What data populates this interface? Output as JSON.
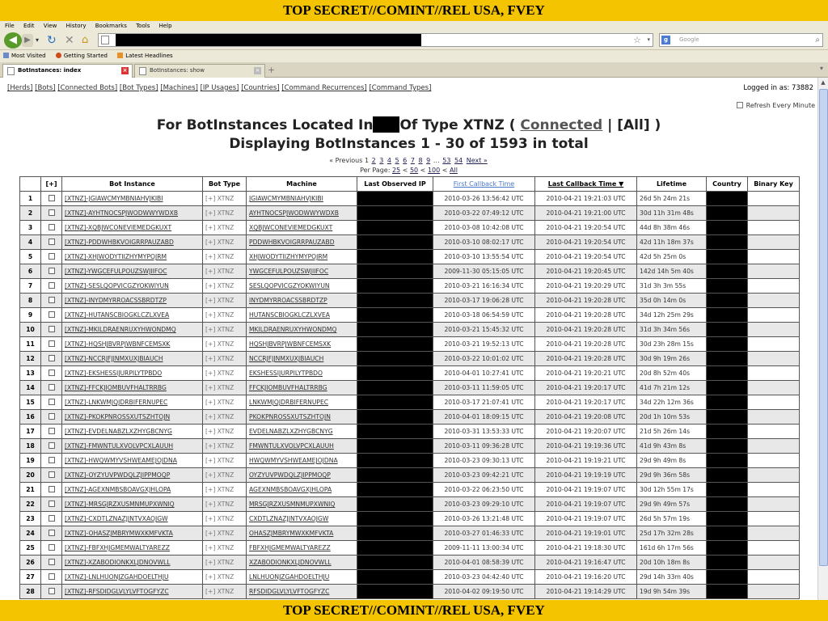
{
  "classification": "TOP SECRET//COMINT//REL USA, FVEY",
  "browser": {
    "menu": [
      "File",
      "Edit",
      "View",
      "History",
      "Bookmarks",
      "Tools",
      "Help"
    ],
    "search_placeholder": "Google",
    "bookmarks": [
      "Most Visited",
      "Getting Started",
      "Latest Headlines"
    ],
    "tabs": [
      {
        "label": "BotInstances: index",
        "active": true
      },
      {
        "label": "BotInstances: show",
        "active": false
      }
    ]
  },
  "nav": {
    "links": [
      "[Herds]",
      "[Bots]",
      "[Connected Bots]",
      "[Bot Types]",
      "[Machines]",
      "[IP Usages]",
      "[Countries]",
      "[Command Recurrences]",
      "[Command Types]"
    ],
    "logged_in_label": "Logged in as: 73882",
    "refresh_label": "Refresh Every Minute"
  },
  "heading": {
    "prefix": "For BotInstances Located In",
    "type_text": "Of Type XTNZ ( ",
    "connected": "Connected",
    "sep": " | ",
    "all": "[All]",
    "suffix": " )",
    "line2": "Displaying BotInstances 1 - 30 of 1593 in total"
  },
  "pager": {
    "previous": "« Previous",
    "pages": [
      "1",
      "2",
      "3",
      "4",
      "5",
      "6",
      "7",
      "8",
      "9"
    ],
    "ellipsis": "…",
    "end_pages": [
      "53",
      "54"
    ],
    "next": "Next »",
    "per_page_label": "Per Page:",
    "per_page": [
      "25",
      "50",
      "100",
      "All"
    ]
  },
  "table": {
    "headers": [
      "",
      "[+]",
      "Bot Instance",
      "Bot Type",
      "Machine",
      "Last Observed IP",
      "First Callback Time",
      "Last Callback Time ▼",
      "Lifetime",
      "Country",
      "Binary Key"
    ],
    "rows": [
      {
        "n": "1",
        "inst": "[XTNZ]-JGIAWCMYMBNIAHVJKIBI",
        "type": "[+] XTNZ",
        "mach": "JGIAWCMYMBNIAHVJKIBI",
        "first": "2010-03-26 13:56:42 UTC",
        "last": "2010-04-21 19:21:03 UTC",
        "life": "26d 5h 24m 21s"
      },
      {
        "n": "2",
        "inst": "[XTNZ]-AYHTNOCSPJWODWWYWDXB",
        "type": "[+] XTNZ",
        "mach": "AYHTNOCSPJWODWWYWDXB",
        "first": "2010-03-22 07:49:12 UTC",
        "last": "2010-04-21 19:21:00 UTC",
        "life": "30d 11h 31m 48s"
      },
      {
        "n": "3",
        "inst": "[XTNZ]-XQBJWCONEVIEMEDGKUXT",
        "type": "[+] XTNZ",
        "mach": "XQBJWCONEVIEMEDGKUXT",
        "first": "2010-03-08 10:42:08 UTC",
        "last": "2010-04-21 19:20:54 UTC",
        "life": "44d 8h 38m 46s"
      },
      {
        "n": "4",
        "inst": "[XTNZ]-PDDWHBKVOIGRRPAUZABD",
        "type": "[+] XTNZ",
        "mach": "PDDWHBKVOIGRRPAUZABD",
        "first": "2010-03-10 08:02:17 UTC",
        "last": "2010-04-21 19:20:54 UTC",
        "life": "42d 11h 18m 37s"
      },
      {
        "n": "5",
        "inst": "[XTNZ]-XHJWODYTIIZHYMYPOJRM",
        "type": "[+] XTNZ",
        "mach": "XHJWODYTIIZHYMYPOJRM",
        "first": "2010-03-10 13:55:54 UTC",
        "last": "2010-04-21 19:20:54 UTC",
        "life": "42d 5h 25m 0s"
      },
      {
        "n": "6",
        "inst": "[XTNZ]-YWGCEFULPOUZSWJIIFOC",
        "type": "[+] XTNZ",
        "mach": "YWGCEFULPOUZSWJIIFOC",
        "first": "2009-11-30 05:15:05 UTC",
        "last": "2010-04-21 19:20:45 UTC",
        "life": "142d 14h 5m 40s"
      },
      {
        "n": "7",
        "inst": "[XTNZ]-SESLQOPVICGZYOKWIYUN",
        "type": "[+] XTNZ",
        "mach": "SESLQOPVICGZYOKWIYUN",
        "first": "2010-03-21 16:16:34 UTC",
        "last": "2010-04-21 19:20:29 UTC",
        "life": "31d 3h 3m 55s"
      },
      {
        "n": "8",
        "inst": "[XTNZ]-INYDMYRROACSSBRDTZP",
        "type": "[+] XTNZ",
        "mach": "INYDMYRROACSSBRDTZP",
        "first": "2010-03-17 19:06:28 UTC",
        "last": "2010-04-21 19:20:28 UTC",
        "life": "35d 0h 14m 0s"
      },
      {
        "n": "9",
        "inst": "[XTNZ]-HUTANSCBIOGKLCZLXVEA",
        "type": "[+] XTNZ",
        "mach": "HUTANSCBIOGKLCZLXVEA",
        "first": "2010-03-18 06:54:59 UTC",
        "last": "2010-04-21 19:20:28 UTC",
        "life": "34d 12h 25m 29s"
      },
      {
        "n": "10",
        "inst": "[XTNZ]-MKILDRAENRUXYHWONDMQ",
        "type": "[+] XTNZ",
        "mach": "MKILDRAENRUXYHWONDMQ",
        "first": "2010-03-21 15:45:32 UTC",
        "last": "2010-04-21 19:20:28 UTC",
        "life": "31d 3h 34m 56s"
      },
      {
        "n": "11",
        "inst": "[XTNZ]-HQSHJBVRPJWBNFCEMSXK",
        "type": "[+] XTNZ",
        "mach": "HQSHJBVRPJWBNFCEMSXK",
        "first": "2010-03-21 19:52:13 UTC",
        "last": "2010-04-21 19:20:28 UTC",
        "life": "30d 23h 28m 15s"
      },
      {
        "n": "12",
        "inst": "[XTNZ]-NCCRJFJJNMXUXJBIAUCH",
        "type": "[+] XTNZ",
        "mach": "NCCRJFJJNMXUXJBIAUCH",
        "first": "2010-03-22 10:01:02 UTC",
        "last": "2010-04-21 19:20:28 UTC",
        "life": "30d 9h 19m 26s"
      },
      {
        "n": "13",
        "inst": "[XTNZ]-EKSHESSIJURPILYTPBDO",
        "type": "[+] XTNZ",
        "mach": "EKSHESSIJURPILYTPBDO",
        "first": "2010-04-01 10:27:41 UTC",
        "last": "2010-04-21 19:20:21 UTC",
        "life": "20d 8h 52m 40s"
      },
      {
        "n": "14",
        "inst": "[XTNZ]-FFCKJIOMBUVFHALTRRBG",
        "type": "[+] XTNZ",
        "mach": "FFCKJIOMBUVFHALTRRBG",
        "first": "2010-03-11 11:59:05 UTC",
        "last": "2010-04-21 19:20:17 UTC",
        "life": "41d 7h 21m 12s"
      },
      {
        "n": "15",
        "inst": "[XTNZ]-LNKWMJQJDRBIFERNUPEC",
        "type": "[+] XTNZ",
        "mach": "LNKWMJQJDRBIFERNUPEC",
        "first": "2010-03-17 21:07:41 UTC",
        "last": "2010-04-21 19:20:17 UTC",
        "life": "34d 22h 12m 36s"
      },
      {
        "n": "16",
        "inst": "[XTNZ]-PKOKPNROSSXUTSZHTOJN",
        "type": "[+] XTNZ",
        "mach": "PKOKPNROSSXUTSZHTOJN",
        "first": "2010-04-01 18:09:15 UTC",
        "last": "2010-04-21 19:20:08 UTC",
        "life": "20d 1h 10m 53s"
      },
      {
        "n": "17",
        "inst": "[XTNZ]-EVDELNABZLXZHYGBCNYG",
        "type": "[+] XTNZ",
        "mach": "EVDELNABZLXZHYGBCNYG",
        "first": "2010-03-31 13:53:33 UTC",
        "last": "2010-04-21 19:20:07 UTC",
        "life": "21d 5h 26m 14s"
      },
      {
        "n": "18",
        "inst": "[XTNZ]-FMWNTULXVOLVPCXLAUUH",
        "type": "[+] XTNZ",
        "mach": "FMWNTULXVOLVPCXLAUUH",
        "first": "2010-03-11 09:36:28 UTC",
        "last": "2010-04-21 19:19:36 UTC",
        "life": "41d 9h 43m 8s"
      },
      {
        "n": "19",
        "inst": "[XTNZ]-HWQWMYVSHWEAMEJOJDNA",
        "type": "[+] XTNZ",
        "mach": "HWQWMYVSHWEAMEJOJDNA",
        "first": "2010-03-23 09:30:13 UTC",
        "last": "2010-04-21 19:19:21 UTC",
        "life": "29d 9h 49m 8s"
      },
      {
        "n": "20",
        "inst": "[XTNZ]-OYZYUVPWDQLZJIPPMOQP",
        "type": "[+] XTNZ",
        "mach": "OYZYUVPWDQLZJIPPMOQP",
        "first": "2010-03-23 09:42:21 UTC",
        "last": "2010-04-21 19:19:19 UTC",
        "life": "29d 9h 36m 58s"
      },
      {
        "n": "21",
        "inst": "[XTNZ]-AGEXNMBSBOAVGXJHLOPA",
        "type": "[+] XTNZ",
        "mach": "AGEXNMBSBOAVGXJHLOPA",
        "first": "2010-03-22 06:23:50 UTC",
        "last": "2010-04-21 19:19:07 UTC",
        "life": "30d 12h 55m 17s"
      },
      {
        "n": "22",
        "inst": "[XTNZ]-MRSGJRZXUSMNMUPXWNIQ",
        "type": "[+] XTNZ",
        "mach": "MRSGJRZXUSMNMUPXWNIQ",
        "first": "2010-03-23 09:29:10 UTC",
        "last": "2010-04-21 19:19:07 UTC",
        "life": "29d 9h 49m 57s"
      },
      {
        "n": "23",
        "inst": "[XTNZ]-CXDTLZNAZJJNTVXAOJGW",
        "type": "[+] XTNZ",
        "mach": "CXDTLZNAZJJNTVXAOJGW",
        "first": "2010-03-26 13:21:48 UTC",
        "last": "2010-04-21 19:19:07 UTC",
        "life": "26d 5h 57m 19s"
      },
      {
        "n": "24",
        "inst": "[XTNZ]-OHASZJMBRYMWXKMFVKTA",
        "type": "[+] XTNZ",
        "mach": "OHASZJMBRYMWXKMFVKTA",
        "first": "2010-03-27 01:46:33 UTC",
        "last": "2010-04-21 19:19:01 UTC",
        "life": "25d 17h 32m 28s"
      },
      {
        "n": "25",
        "inst": "[XTNZ]-FBFXHJGMEMWALTYAREZZ",
        "type": "[+] XTNZ",
        "mach": "FBFXHJGMEMWALTYAREZZ",
        "first": "2009-11-11 13:00:34 UTC",
        "last": "2010-04-21 19:18:30 UTC",
        "life": "161d 6h 17m 56s"
      },
      {
        "n": "26",
        "inst": "[XTNZ]-XZABODIONKXLJDNOVWLL",
        "type": "[+] XTNZ",
        "mach": "XZABODIONKXLJDNOVWLL",
        "first": "2010-04-01 08:58:39 UTC",
        "last": "2010-04-21 19:16:47 UTC",
        "life": "20d 10h 18m 8s"
      },
      {
        "n": "27",
        "inst": "[XTNZ]-LNLHUONJZGAHDOELTHJU",
        "type": "[+] XTNZ",
        "mach": "LNLHUONJZGAHDOELTHJU",
        "first": "2010-03-23 04:42:40 UTC",
        "last": "2010-04-21 19:16:20 UTC",
        "life": "29d 14h 33m 40s"
      },
      {
        "n": "28",
        "inst": "[XTNZ]-RFSDIDGLVLYLVFTOGFYZC",
        "type": "[+] XTNZ",
        "mach": "RFSDIDGLVLYLVFTOGFYZC",
        "first": "2010-04-02 09:19:50 UTC",
        "last": "2010-04-21 19:14:29 UTC",
        "life": "19d 9h 54m 39s"
      }
    ]
  }
}
